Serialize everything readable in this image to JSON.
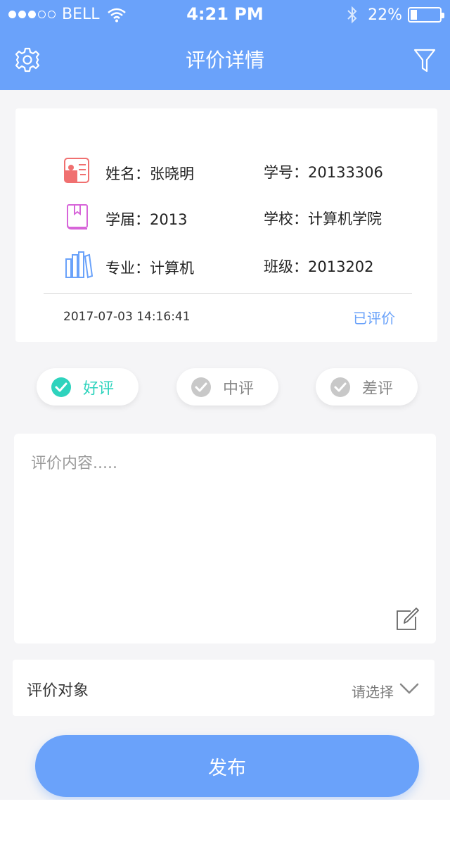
{
  "status_bar": {
    "carrier": "BELL",
    "time": "4:21 PM",
    "battery_percent_text": "22%",
    "battery_level": 0.22,
    "signal_bars_filled": 3,
    "signal_bars_total": 5
  },
  "nav": {
    "title": "评价详情",
    "left_icon": "gear-icon",
    "right_icon": "filter-icon"
  },
  "student": {
    "name_text": "姓名：张晓明",
    "id_text": "学号：20133306",
    "grade_text": "学届：2013",
    "school_text": "学校：计算机学院",
    "major_text": "专业：计算机",
    "class_text": "班级：2013202",
    "datetime": "2017-07-03 14:16:41",
    "status": "已评价"
  },
  "ratings": {
    "good": "好评",
    "medium": "中评",
    "bad": "差评",
    "selected": "good"
  },
  "comment": {
    "placeholder": "评价内容.....",
    "value": ""
  },
  "target": {
    "label": "评价对象",
    "value": "请选择"
  },
  "publish_label": "发布",
  "colors": {
    "primary": "#6aa2fa",
    "accent": "#2ed3bd",
    "inactive": "#c8c8c8",
    "background": "#f5f5f7"
  }
}
